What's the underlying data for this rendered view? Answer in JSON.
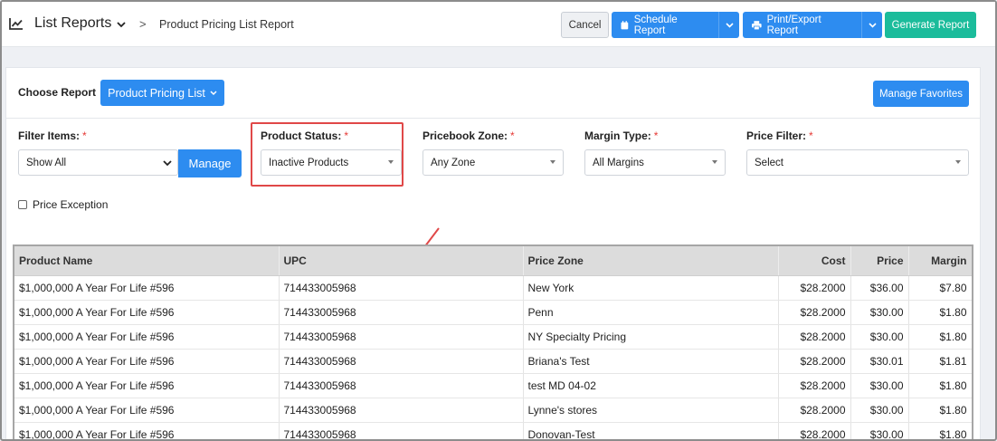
{
  "header": {
    "app_title": "List Reports",
    "breadcrumb_sep": ">",
    "breadcrumb": "Product Pricing List Report",
    "cancel_label": "Cancel",
    "schedule_label": "Schedule Report",
    "print_label": "Print/Export Report",
    "generate_label": "Generate Report"
  },
  "report": {
    "choose_label": "Choose Report",
    "selected": "Product Pricing List",
    "manage_favorites_label": "Manage Favorites"
  },
  "filters": {
    "required_mark": "*",
    "filter_items": {
      "label": "Filter Items:",
      "value": "Show All",
      "manage_label": "Manage"
    },
    "product_status": {
      "label": "Product Status:",
      "value": "Inactive Products"
    },
    "pricebook_zone": {
      "label": "Pricebook Zone:",
      "value": "Any Zone"
    },
    "margin_type": {
      "label": "Margin Type:",
      "value": "All Margins"
    },
    "price_filter": {
      "label": "Price Filter:",
      "value": "Select"
    },
    "price_exception_label": "Price Exception"
  },
  "table": {
    "columns": [
      "Product Name",
      "UPC",
      "Price Zone",
      "Cost",
      "Price",
      "Margin"
    ],
    "rows": [
      [
        "$1,000,000 A Year For Life #596",
        "714433005968",
        "New York",
        "$28.2000",
        "$36.00",
        "$7.80"
      ],
      [
        "$1,000,000 A Year For Life #596",
        "714433005968",
        "Penn",
        "$28.2000",
        "$30.00",
        "$1.80"
      ],
      [
        "$1,000,000 A Year For Life #596",
        "714433005968",
        "NY Specialty Pricing",
        "$28.2000",
        "$30.00",
        "$1.80"
      ],
      [
        "$1,000,000 A Year For Life #596",
        "714433005968",
        "Briana's Test",
        "$28.2000",
        "$30.01",
        "$1.81"
      ],
      [
        "$1,000,000 A Year For Life #596",
        "714433005968",
        "test MD 04-02",
        "$28.2000",
        "$30.00",
        "$1.80"
      ],
      [
        "$1,000,000 A Year For Life #596",
        "714433005968",
        "Lynne's stores",
        "$28.2000",
        "$30.00",
        "$1.80"
      ],
      [
        "$1,000,000 A Year For Life #596",
        "714433005968",
        "Donovan-Test",
        "$28.2000",
        "$30.00",
        "$1.80"
      ]
    ]
  },
  "colors": {
    "primary": "#2d8cf0",
    "success": "#1bbc9b",
    "annotation": "#e04848"
  }
}
